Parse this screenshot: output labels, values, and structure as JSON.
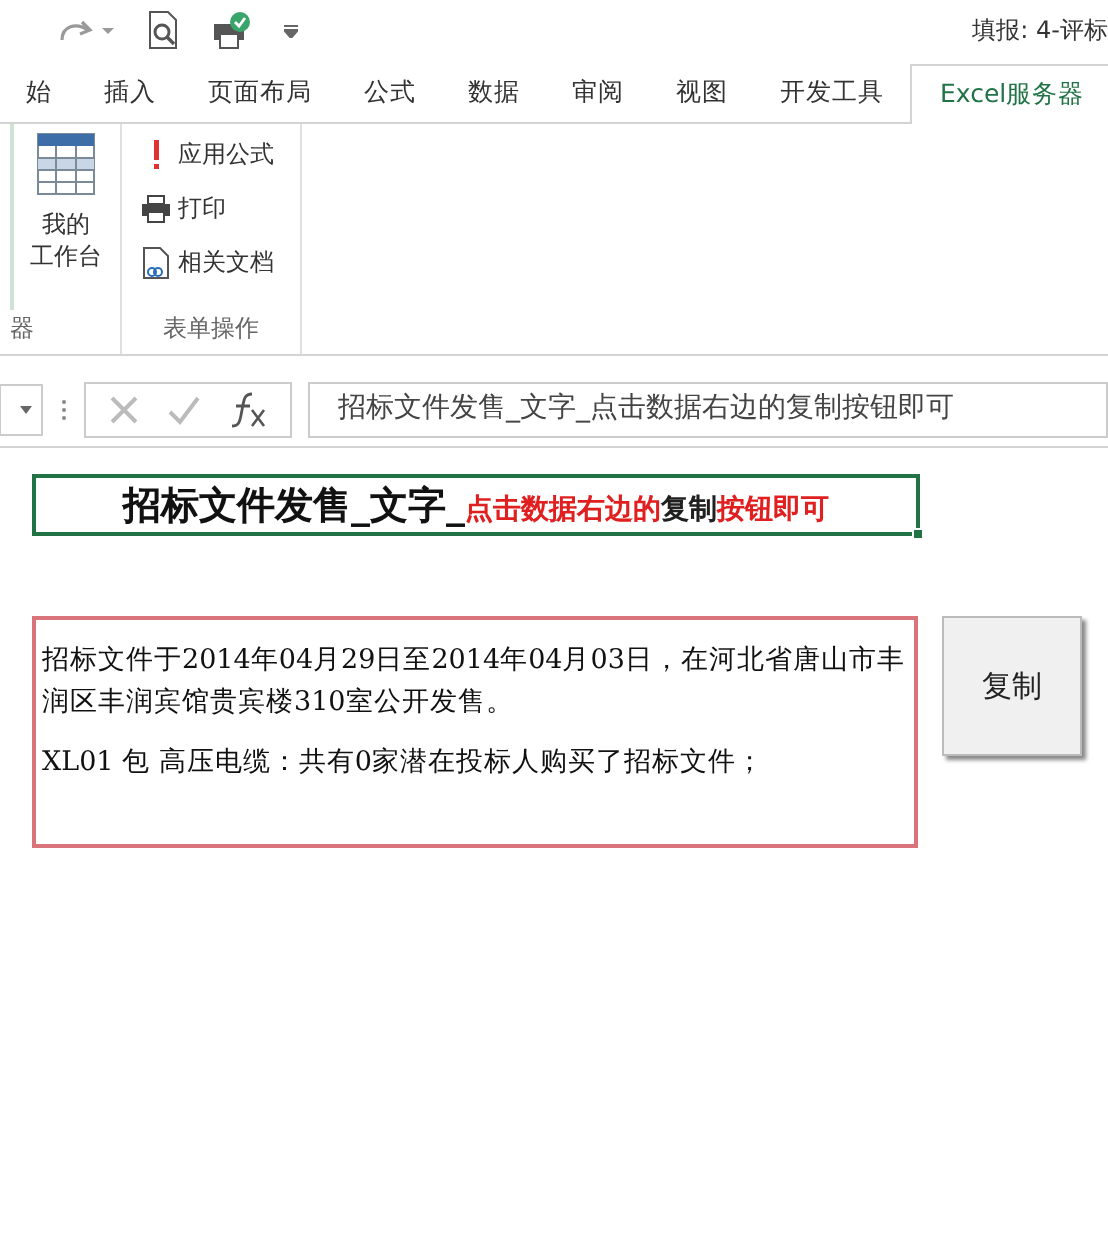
{
  "window": {
    "title": "填报: 4-评标"
  },
  "tabs": [
    {
      "label": "始",
      "selected": false
    },
    {
      "label": "插入",
      "selected": false
    },
    {
      "label": "页面布局",
      "selected": false
    },
    {
      "label": "公式",
      "selected": false
    },
    {
      "label": "数据",
      "selected": false
    },
    {
      "label": "审阅",
      "selected": false
    },
    {
      "label": "视图",
      "selected": false
    },
    {
      "label": "开发工具",
      "selected": false
    },
    {
      "label": "Excel服务器",
      "selected": true
    }
  ],
  "ribbon": {
    "groups": [
      {
        "label": "器",
        "buttons": [
          {
            "lines": [
              "我的",
              "工作台"
            ],
            "kind": "table"
          }
        ]
      },
      {
        "label": "表单操作",
        "buttons": [
          {
            "label": "应用公式",
            "kind": "exclaim"
          },
          {
            "label": "打印",
            "kind": "printer"
          },
          {
            "label": "相关文档",
            "kind": "document"
          }
        ]
      }
    ]
  },
  "formula_bar": {
    "value": "招标文件发售_文字_点击数据右边的复制按钮即可"
  },
  "sheet": {
    "title_cell": {
      "segments": [
        {
          "text": "招标文件发售_文字_",
          "kind": "heading"
        },
        {
          "text": "点击数据右边的",
          "kind": "note",
          "color": "#e02020"
        },
        {
          "text": "复制",
          "kind": "note",
          "color": "#202020"
        },
        {
          "text": "按钮即可",
          "kind": "note",
          "color": "#e02020"
        }
      ]
    },
    "text_box": {
      "paragraphs": [
        "招标文件于2014年04月29日至2014年04月03日，在河北省唐山市丰润区丰润宾馆贵宾楼310室公开发售。",
        "XL01 包 高压电缆：共有0家潜在投标人购买了招标文件；"
      ]
    },
    "copy_button": {
      "label": "复制"
    }
  }
}
